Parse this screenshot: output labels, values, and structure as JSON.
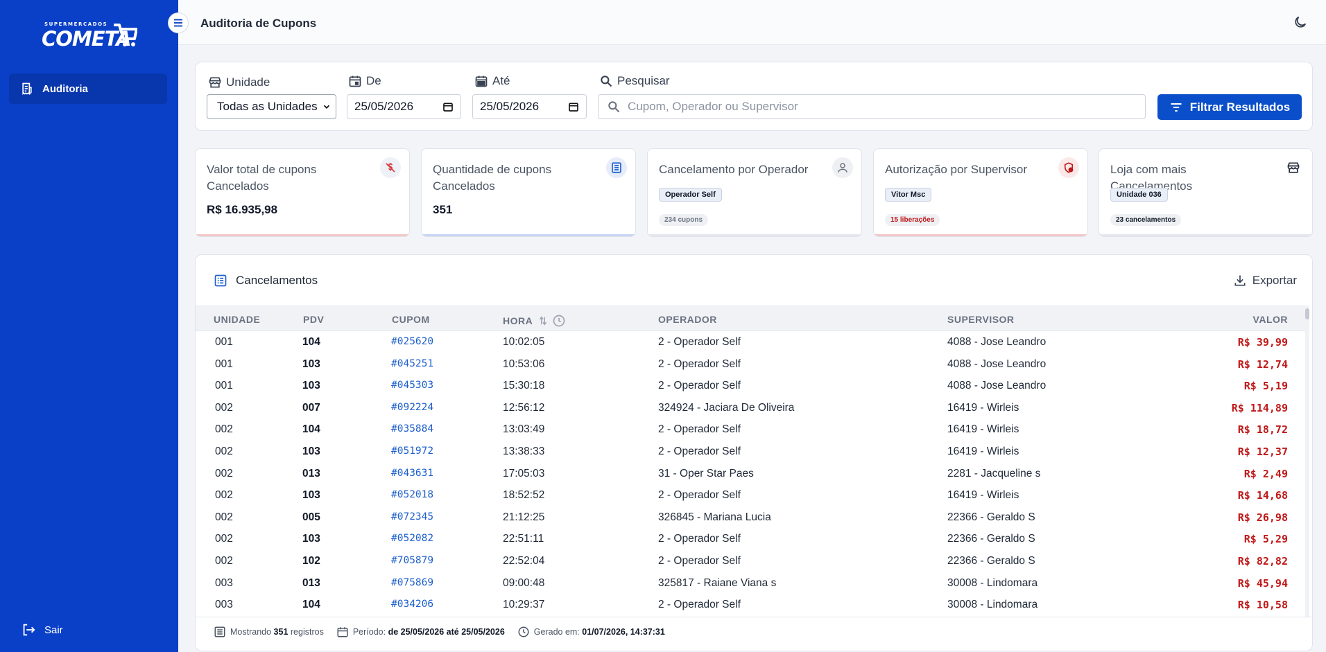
{
  "brand": {
    "small": "SUPERMERCADOS",
    "name": "COMETA"
  },
  "sidebar": {
    "items": [
      {
        "label": "Auditoria"
      }
    ],
    "logout_label": "Sair"
  },
  "header": {
    "title": "Auditoria de Cupons"
  },
  "filters": {
    "unit_label": "Unidade",
    "unit_value": "Todas as Unidades",
    "from_label": "De",
    "from_value": "25/05/2026",
    "to_label": "Até",
    "to_value": "25/05/2026",
    "search_label": "Pesquisar",
    "search_placeholder": "Cupom, Operador ou Supervisor",
    "filter_button": "Filtrar Resultados"
  },
  "stats": {
    "total_value": {
      "title": "Valor total de cupons Cancelados",
      "value": "R$ 16.935,98",
      "accent": "#f4c7c7"
    },
    "quantity": {
      "title": "Quantidade de cupons Cancelados",
      "value": "351",
      "accent": "#c7d6f4"
    },
    "by_operator": {
      "title": "Cancelamento por Operador",
      "badge": "Operador Self",
      "sub": "234 cupons"
    },
    "by_supervisor": {
      "title": "Autorização por Supervisor",
      "badge": "Vitor Msc",
      "sub": "15 liberações",
      "accent": "#f4c7c7"
    },
    "top_store": {
      "title": "Loja com mais Cancelamentos",
      "badge": "Unidade 036",
      "sub": "23 cancelamentos"
    }
  },
  "table": {
    "title": "Cancelamentos",
    "export_label": "Exportar",
    "columns": [
      "UNIDADE",
      "PDV",
      "CUPOM",
      "HORA",
      "OPERADOR",
      "SUPERVISOR",
      "VALOR"
    ],
    "rows": [
      [
        "001",
        "104",
        "#025620",
        "10:02:05",
        "2 - Operador Self",
        "4088 - Jose Leandro",
        "R$ 39,99"
      ],
      [
        "001",
        "103",
        "#045251",
        "10:53:06",
        "2 - Operador Self",
        "4088 - Jose Leandro",
        "R$ 12,74"
      ],
      [
        "001",
        "103",
        "#045303",
        "15:30:18",
        "2 - Operador Self",
        "4088 - Jose Leandro",
        "R$ 5,19"
      ],
      [
        "002",
        "007",
        "#092224",
        "12:56:12",
        "324924 - Jaciara De Oliveira",
        "16419 - Wirleis",
        "R$ 114,89"
      ],
      [
        "002",
        "104",
        "#035884",
        "13:03:49",
        "2 - Operador Self",
        "16419 - Wirleis",
        "R$ 18,72"
      ],
      [
        "002",
        "103",
        "#051972",
        "13:38:33",
        "2 - Operador Self",
        "16419 - Wirleis",
        "R$ 12,37"
      ],
      [
        "002",
        "013",
        "#043631",
        "17:05:03",
        "31 - Oper Star Paes",
        "2281 - Jacqueline s",
        "R$ 2,49"
      ],
      [
        "002",
        "103",
        "#052018",
        "18:52:52",
        "2 - Operador Self",
        "16419 - Wirleis",
        "R$ 14,68"
      ],
      [
        "002",
        "005",
        "#072345",
        "21:12:25",
        "326845 - Mariana Lucia",
        "22366 - Geraldo S",
        "R$ 26,98"
      ],
      [
        "002",
        "103",
        "#052082",
        "22:51:11",
        "2 - Operador Self",
        "22366 - Geraldo S",
        "R$ 5,29"
      ],
      [
        "002",
        "102",
        "#705879",
        "22:52:04",
        "2 - Operador Self",
        "22366 - Geraldo S",
        "R$ 82,82"
      ],
      [
        "003",
        "013",
        "#075869",
        "09:00:48",
        "325817 - Raiane Viana s",
        "30008 - Lindomara",
        "R$ 45,94"
      ],
      [
        "003",
        "104",
        "#034206",
        "10:29:37",
        "2 - Operador Self",
        "30008 - Lindomara",
        "R$ 10,58"
      ]
    ],
    "footer": {
      "showing_prefix": "Mostrando",
      "showing_count": "351",
      "showing_suffix": "registros",
      "period_label": "Período:",
      "period_value": "de 25/05/2026 até 25/05/2026",
      "generated_label": "Gerado em:",
      "generated_value": "01/07/2026, 14:37:31"
    }
  },
  "colors": {
    "sidebar": "#0a3fc7",
    "primary": "#0a4fc9",
    "danger": "#c01818",
    "link": "#1d5fcc"
  },
  "icons": [
    "menu-icon",
    "moon-icon",
    "store-icon",
    "calendar-icon",
    "search-icon",
    "filter-icon",
    "money-off-icon",
    "list-icon",
    "user-icon",
    "shield-icon",
    "storefront-icon",
    "export-icon",
    "logout-icon",
    "clock-icon",
    "sort-icon",
    "receipt-icon"
  ]
}
